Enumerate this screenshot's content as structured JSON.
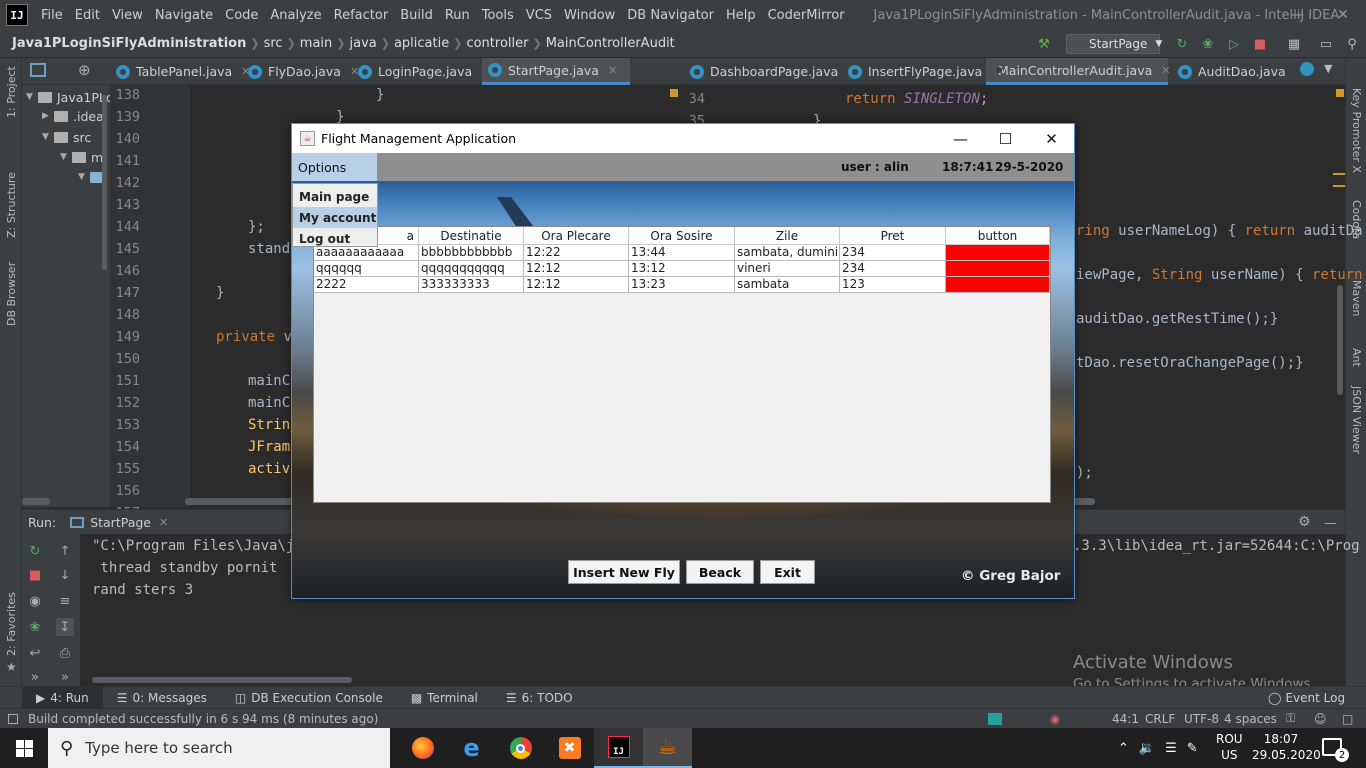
{
  "ide": {
    "menu": [
      "File",
      "Edit",
      "View",
      "Navigate",
      "Code",
      "Analyze",
      "Refactor",
      "Build",
      "Run",
      "Tools",
      "VCS",
      "Window",
      "DB Navigator",
      "Help",
      "CoderMirror"
    ],
    "window_title": "Java1PLoginSiFlyAdministration - MainControllerAudit.java - IntelliJ IDEA",
    "breadcrumb": [
      "Java1PLoginSiFlyAdministration",
      "src",
      "main",
      "java",
      "aplicatie",
      "controller",
      "MainControllerAudit"
    ],
    "run_config": "StartPage",
    "left_tabs": [
      "TablePanel.java",
      "FlyDao.java",
      "LoginPage.java",
      "StartPage.java"
    ],
    "right_tabs": [
      "DashboardPage.java",
      "InsertFlyPage.java",
      "MainControllerAudit.java",
      "AuditDao.java"
    ],
    "left_strip": [
      "1: Project",
      "Z: Structure",
      "DB Browser",
      "2: Favorites"
    ],
    "right_strip": [
      "Key Promoter X",
      "Codota",
      "Maven",
      "Ant",
      "JSON Viewer"
    ],
    "tree": [
      "Java1PLc",
      ".idea",
      "src",
      "m"
    ],
    "line_numbers": [
      "138",
      "139",
      "140",
      "141",
      "142",
      "143",
      "144",
      "145",
      "146",
      "147",
      "148",
      "149",
      "150",
      "151",
      "152",
      "153",
      "154",
      "155",
      "156",
      "157"
    ],
    "right_line_numbers": [
      "34",
      "35"
    ],
    "code_left": {
      "l138": "}",
      "l139": "}",
      "l144": "};",
      "l146": "standb",
      "l148": "}",
      "l150_kw": "private ",
      "l150_rest": "vo",
      "l152": "mainCo",
      "l153": "mainCo",
      "l154": "String",
      "l155": "JFrame",
      "l156": "active"
    },
    "code_right": {
      "l34_kw": "return ",
      "l34_it": "SINGLETON",
      "l34_end": ";",
      "l35": "}",
      "r1_a": "ring ",
      "r1_b": "userNameLog) { ",
      "r1_kw": "return ",
      "r1_c": "auditDa",
      "r2_a": "iewPage, ",
      "r2_b": "String ",
      "r2_c": "userName) { ",
      "r2_kw": "return",
      "r3": "auditDao.getRestTime();}",
      "r4": "tDao.resetOraChangePage();}",
      "r5": ");"
    },
    "run_panel": {
      "label": "Run:",
      "tab": "StartPage",
      "console": [
        "\"C:\\Program Files\\Java\\jd",
        " thread standby pornit",
        "rand sters 3"
      ],
      "console_right": ".3.3\\lib\\idea_rt.jar=52644:C:\\Prog"
    },
    "bottom_tabs": [
      "4: Run",
      "0: Messages",
      "DB Execution Console",
      "Terminal",
      "6: TODO"
    ],
    "event_log": "Event Log",
    "status": {
      "message": "Build completed successfully in 6 s 94 ms (8 minutes ago)",
      "position": "44:1",
      "line_sep": "CRLF",
      "encoding": "UTF-8",
      "indent": "4 spaces"
    },
    "activate": {
      "title": "Activate Windows",
      "subtitle": "Go to Settings to activate Windows."
    }
  },
  "app": {
    "title": "Flight Management Application",
    "menu_label": "Options",
    "menu_items": [
      "Main page",
      "My account",
      "Log out"
    ],
    "user": "user : alin",
    "time": "18:7:41",
    "date": "29-5-2020",
    "table": {
      "first_header_visible": "a",
      "headers": [
        "Destinatie",
        "Ora Plecare",
        "Ora Sosire",
        "Zile",
        "Pret",
        "button"
      ],
      "rows": [
        [
          "aaaaaaaaaaaa",
          "bbbbbbbbbbbb",
          "12:22",
          "13:44",
          "sambata, dumini...",
          "234",
          ""
        ],
        [
          "qqqqqq",
          "qqqqqqqqqqq",
          "12:12",
          "13:12",
          "vineri",
          "234",
          ""
        ],
        [
          "2222",
          "333333333",
          "12:12",
          "13:23",
          "sambata",
          "123",
          ""
        ]
      ]
    },
    "buttons": [
      "Insert New Fly",
      "Beack",
      "Exit"
    ],
    "credit": "© Greg Bajor"
  },
  "taskbar": {
    "search_placeholder": "Type here to search",
    "lang": "ROU",
    "region": "US",
    "time": "18:07",
    "date": "29.05.2020",
    "notifications": "2"
  },
  "colors": {
    "accent": "#4a88c7",
    "button_cell": "#ff0000",
    "menu_highlight": "#b8cfe5"
  }
}
